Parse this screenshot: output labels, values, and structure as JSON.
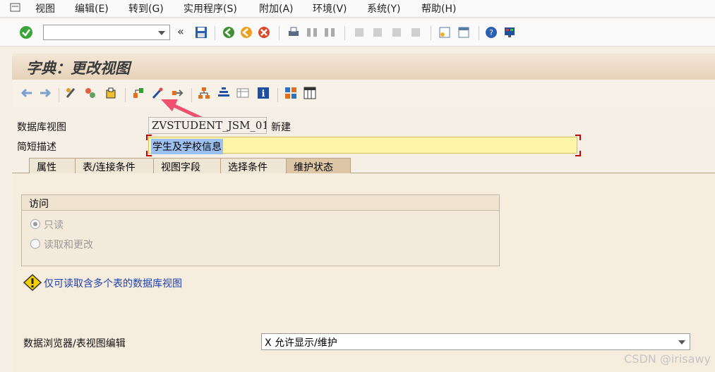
{
  "menu": [
    "视图",
    "编辑(E)",
    "转到(G)",
    "实用程序(S)",
    "附加(A)",
    "环境(V)",
    "系统(Y)",
    "帮助(H)"
  ],
  "title": "字典：更改视图",
  "fields": {
    "db_view_label": "数据库视图",
    "db_view_value": "ZVSTUDENT_JSM_01",
    "db_view_status": "新建",
    "short_desc_label": "简短描述",
    "short_desc_value": "学生及学校信息"
  },
  "tabs": [
    "属性",
    "表/连接条件",
    "视图字段",
    "选择条件",
    "维护状态"
  ],
  "active_tab": "维护状态",
  "access": {
    "title": "访问",
    "options": [
      "只读",
      "读取和更改"
    ],
    "selected": "只读"
  },
  "warning": "仅可读取含多个表的数据库视图",
  "browser": {
    "label": "数据浏览器/表视图编辑",
    "value": "X 允许显示/维护"
  },
  "watermark": "CSDN @irisawy",
  "colors": {
    "title_bg": "#e6d2b8",
    "desc_bg": "#fff5a8",
    "link": "#1a3fb0",
    "arrow": "#f0506e"
  }
}
